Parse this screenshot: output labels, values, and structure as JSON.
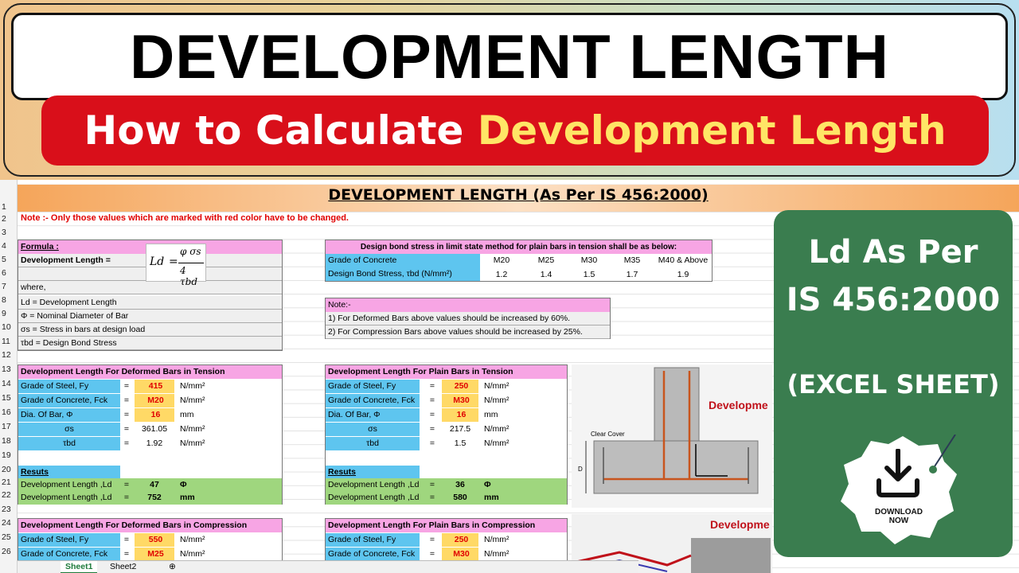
{
  "banner": {
    "title": "DEVELOPMENT LENGTH",
    "subtitle_white": "How to Calculate",
    "subtitle_yellow": "Development Length"
  },
  "sheet": {
    "header": "DEVELOPMENT LENGTH (As Per IS 456:2000)",
    "note": "Note :-  Only those values which are marked with red color have to be changed.",
    "row_numbers": [
      "1",
      "2",
      "3",
      "4",
      "5",
      "6",
      "7",
      "8",
      "9",
      "10",
      "11",
      "12",
      "13",
      "14",
      "15",
      "16",
      "17",
      "18",
      "19",
      "20",
      "21",
      "22",
      "23",
      "24",
      "25",
      "26"
    ],
    "formula": {
      "title": "Formula :",
      "label": "Development Length =",
      "lhs": "Ld",
      "eq": "=",
      "num": "φ σs",
      "den": "4 τbd",
      "where": "where,",
      "defs": [
        "Ld = Development Length",
        "Φ = Nominal Diameter of Bar",
        "σs = Stress in bars at design load",
        "τbd = Design Bond Stress"
      ]
    },
    "bond_table": {
      "title": "Design bond stress in limit state method for plain bars in tension shall be as below:",
      "row1_label": "Grade of Concrete",
      "grades": [
        "M20",
        "M25",
        "M30",
        "M35",
        "M40 & Above"
      ],
      "row2_label": "Design Bond Stress, τbd (N/mm²)",
      "values": [
        "1.2",
        "1.4",
        "1.5",
        "1.7",
        "1.9"
      ]
    },
    "note_box": {
      "title": "Note:-",
      "line1": "1) For Deformed Bars above values should be increased by 60%.",
      "line2": "2) For Compression Bars above values should be increased by 25%."
    },
    "deformed_tension": {
      "title": "Development Length For Deformed Bars in Tension",
      "fy_label": "Grade of Steel, Fy",
      "fy": "415",
      "fck_label": "Grade of Concrete, Fck",
      "fck": "M20",
      "dia_label": "Dia. Of Bar, Φ",
      "dia": "16",
      "sigma_label": "σs",
      "sigma": "361.05",
      "tbd_label": "τbd",
      "tbd": "1.92",
      "results": "Resuts",
      "ld1_label": "Development Length ,Ld",
      "ld1": "47",
      "ld1_unit": "Φ",
      "ld2_label": "Development Length ,Ld",
      "ld2": "752",
      "ld2_unit": "mm"
    },
    "plain_tension": {
      "title": "Development Length For Plain Bars in Tension",
      "fy_label": "Grade of Steel, Fy",
      "fy": "250",
      "fck_label": "Grade of Concrete, Fck",
      "fck": "M30",
      "dia_label": "Dia. Of Bar, Φ",
      "dia": "16",
      "sigma_label": "σs",
      "sigma": "217.5",
      "tbd_label": "τbd",
      "tbd": "1.5",
      "results": "Resuts",
      "ld1_label": "Development Length ,Ld",
      "ld1": "36",
      "ld1_unit": "Φ",
      "ld2_label": "Development Length ,Ld",
      "ld2": "580",
      "ld2_unit": "mm"
    },
    "deformed_compression": {
      "title": "Development Length For Deformed Bars in Compression",
      "fy_label": "Grade of Steel, Fy",
      "fy": "550",
      "fck_label": "Grade of Concrete, Fck",
      "fck": "M25"
    },
    "plain_compression": {
      "title": "Development Length For Plain Bars in Compression",
      "fy_label": "Grade of Steel, Fy",
      "fy": "250",
      "fck_label": "Grade of Concrete, Fck",
      "fck": "M30"
    },
    "units": {
      "nmm2": "N/mm²",
      "mm": "mm",
      "eq": "="
    },
    "drawing": {
      "label1": "Developme",
      "label2": "Clear Cover",
      "label3": "Developme",
      "dim": "D"
    },
    "tabs": [
      "Sheet1",
      "Sheet2"
    ]
  },
  "card": {
    "line1": "Ld As Per",
    "line2": "IS 456:2000",
    "line3": "(EXCEL SHEET)",
    "download1": "DOWNLOAD",
    "download2": "NOW"
  },
  "colors": {
    "red": "#d90f1a",
    "green_card": "#3a7d4f",
    "yellow": "#ffe566"
  }
}
